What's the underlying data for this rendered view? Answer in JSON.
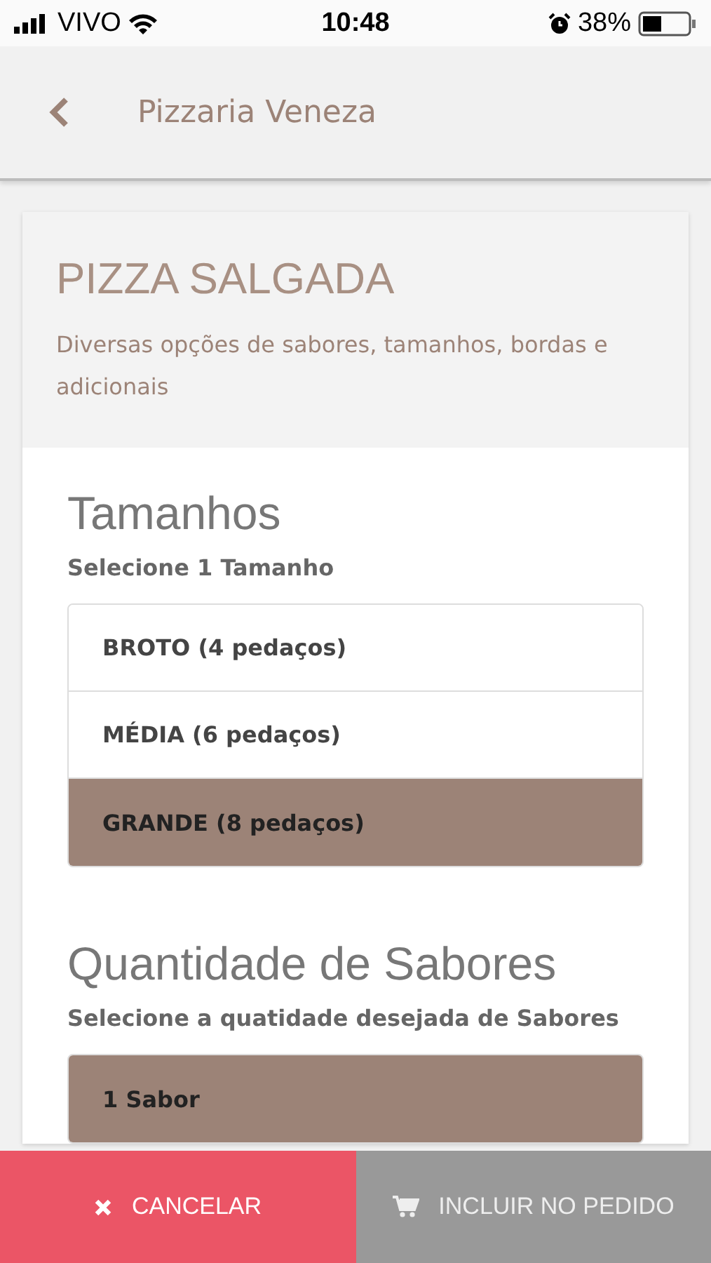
{
  "status_bar": {
    "carrier": "VIVO",
    "time": "10:48",
    "battery": "38%"
  },
  "header": {
    "title": "Pizzaria Veneza"
  },
  "category": {
    "title": "PIZZA SALGADA",
    "description": "Diversas opções de sabores, tamanhos, bordas e adicionais"
  },
  "sections": [
    {
      "title": "Tamanhos",
      "subtitle": "Selecione 1 Tamanho",
      "options": [
        {
          "label": "BROTO (4 pedaços)",
          "selected": false
        },
        {
          "label": "MÉDIA (6 pedaços)",
          "selected": false
        },
        {
          "label": "GRANDE (8 pedaços)",
          "selected": true
        }
      ]
    },
    {
      "title": "Quantidade de Sabores",
      "subtitle": "Selecione a quatidade desejada de Sabores",
      "options": [
        {
          "label": "1 Sabor",
          "selected": true
        }
      ]
    }
  ],
  "actions": [
    {
      "kind": "cancel",
      "label": "CANCELAR"
    },
    {
      "kind": "add",
      "label": "INCLUIR NO PEDIDO"
    }
  ]
}
